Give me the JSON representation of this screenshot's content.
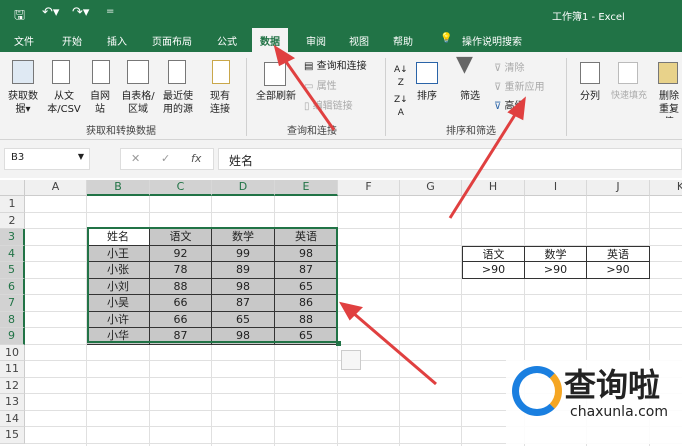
{
  "title": "工作簿1 - Excel",
  "qat": {
    "save": "save-icon",
    "undo": "undo-icon",
    "redo": "redo-icon",
    "customize": "="
  },
  "tabs": [
    "文件",
    "开始",
    "插入",
    "页面布局",
    "公式",
    "数据",
    "审阅",
    "视图",
    "帮助",
    "操作说明搜索"
  ],
  "active_tab": "数据",
  "ribbon": {
    "get_data": "获取数据▾",
    "from_text": "从文本/CSV",
    "from_web": "自网站",
    "from_table": "自表格/区域",
    "recent": "最近使用的源",
    "existing": "现有连接",
    "group1": "获取和转换数据",
    "refresh_all": "全部刷新",
    "queries": "查询和连接",
    "properties": "属性",
    "edit_links": "编辑链接",
    "group2": "查询和连接",
    "sort": "排序",
    "filter": "筛选",
    "clear": "清除",
    "reapply": "重新应用",
    "advanced": "高级",
    "group3": "排序和筛选",
    "text_to_columns": "分列",
    "flash_fill": "快速填充",
    "remove_dup": "删除重复值"
  },
  "formula_bar": {
    "name_box": "B3",
    "cancel": "✕",
    "enter": "✓",
    "fx": "fx",
    "value": "姓名"
  },
  "columns": [
    "A",
    "B",
    "C",
    "D",
    "E",
    "F",
    "G",
    "H",
    "I",
    "J",
    "K"
  ],
  "rows": [
    "1",
    "2",
    "3",
    "4",
    "5",
    "6",
    "7",
    "8",
    "9",
    "10",
    "11",
    "12",
    "13",
    "14",
    "15"
  ],
  "table": {
    "headers": [
      "姓名",
      "语文",
      "数学",
      "英语"
    ],
    "rows": [
      [
        "小王",
        "92",
        "99",
        "98"
      ],
      [
        "小张",
        "78",
        "89",
        "87"
      ],
      [
        "小刘",
        "88",
        "98",
        "65"
      ],
      [
        "小吴",
        "66",
        "87",
        "86"
      ],
      [
        "小许",
        "66",
        "65",
        "88"
      ],
      [
        "小华",
        "87",
        "98",
        "65"
      ]
    ]
  },
  "criteria": {
    "headers": [
      "语文",
      "数学",
      "英语"
    ],
    "values": [
      ">90",
      ">90",
      ">90"
    ]
  },
  "watermark": {
    "brand": "查询啦",
    "url": "chaxunla.com"
  },
  "colors": {
    "excel_green": "#217346",
    "selection_gray": "#c8c8c8",
    "arrow": "#e04040"
  }
}
